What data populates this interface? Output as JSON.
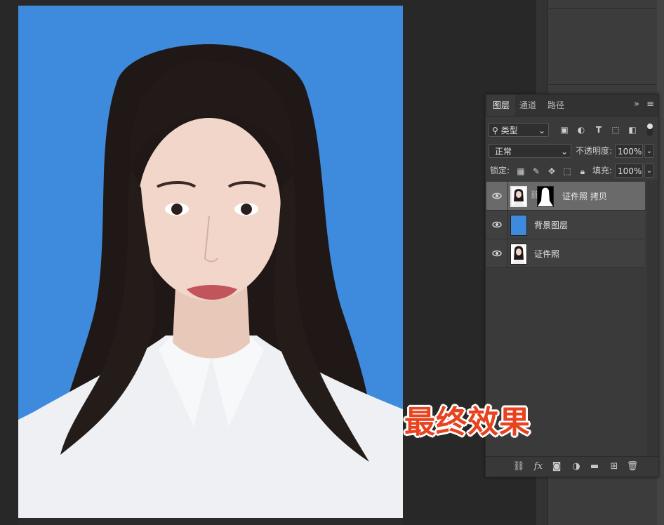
{
  "layers_panel": {
    "tabs": [
      {
        "label": "图层",
        "active": true
      },
      {
        "label": "通道",
        "active": false
      },
      {
        "label": "路径",
        "active": false
      }
    ],
    "filter": {
      "value": "类型"
    },
    "blend_mode": {
      "value": "正常"
    },
    "opacity": {
      "label": "不透明度:",
      "value": "100%"
    },
    "lock": {
      "label": "锁定:"
    },
    "fill": {
      "label": "填充:",
      "value": "100%"
    },
    "layers": [
      {
        "name": "证件照 拷贝",
        "selected": true,
        "has_mask": true,
        "visible": true
      },
      {
        "name": "背景图层",
        "selected": false,
        "has_mask": false,
        "visible": true,
        "thumb_color": "#3e8bdd"
      },
      {
        "name": "证件照",
        "selected": false,
        "has_mask": false,
        "visible": true
      }
    ],
    "footer_icons": [
      "link-icon",
      "fx-icon",
      "add-mask-icon",
      "adjustment-icon",
      "folder-icon",
      "new-layer-icon",
      "trash-icon"
    ]
  },
  "caption": {
    "text": "最终效果",
    "color": "#e8421f"
  },
  "canvas": {
    "background_color": "#3e8bdd"
  }
}
